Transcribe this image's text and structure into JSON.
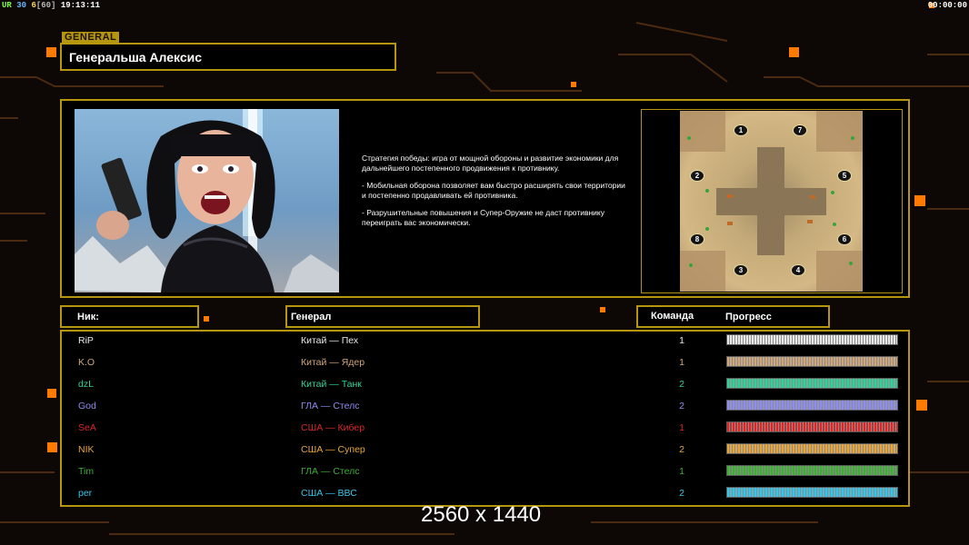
{
  "hud": {
    "ur_label": "UR",
    "fps_a": "30",
    "fps_b": "6",
    "fps_bracket": "[60]",
    "clock": "19:13:11",
    "timer": "00:00:00"
  },
  "section_tag": "GENERAL",
  "general_name": "Генеральша Алексис",
  "strategy": [
    "Стратегия победы: игра от мощной обороны и развитие экономики для дальнейшего постепенного продвижения к противнику.",
    "- Мобильная оборона позволяет вам быстро расширять свои территории и постепенно продавливать ей противника.",
    "- Разрушительные повышения и Супер-Оружие не даст противнику переиграть вас экономически."
  ],
  "map_spawns": [
    "1",
    "7",
    "2",
    "5",
    "8",
    "6",
    "3",
    "4"
  ],
  "headers": {
    "nick": "Ник:",
    "general": "Генерал",
    "team": "Команда",
    "progress": "Прогресс"
  },
  "players": [
    {
      "nick": "RiP",
      "general": "Китай — Пех",
      "team": "1",
      "color": "#e8e8e8",
      "progress": 1.0
    },
    {
      "nick": "K.O",
      "general": "Китай — Ядер",
      "team": "1",
      "color": "#d0a77a",
      "progress": 1.0
    },
    {
      "nick": "dzL",
      "general": "Китай — Танк",
      "team": "2",
      "color": "#2fd39a",
      "progress": 1.0
    },
    {
      "nick": "God",
      "general": "ГЛА — Стелс",
      "team": "2",
      "color": "#8e8ef0",
      "progress": 1.0
    },
    {
      "nick": "SeA",
      "general": "США — Кибер",
      "team": "1",
      "color": "#d82828",
      "progress": 1.0
    },
    {
      "nick": "NIK",
      "general": "США — Супер",
      "team": "2",
      "color": "#e7a63c",
      "progress": 1.0
    },
    {
      "nick": "Tim",
      "general": "ГЛА — Стелс",
      "team": "1",
      "color": "#3cae34",
      "progress": 1.0
    },
    {
      "nick": "per",
      "general": "США — ВВС",
      "team": "2",
      "color": "#38c6e8",
      "progress": 1.0
    }
  ],
  "resolution": "2560 x 1440"
}
